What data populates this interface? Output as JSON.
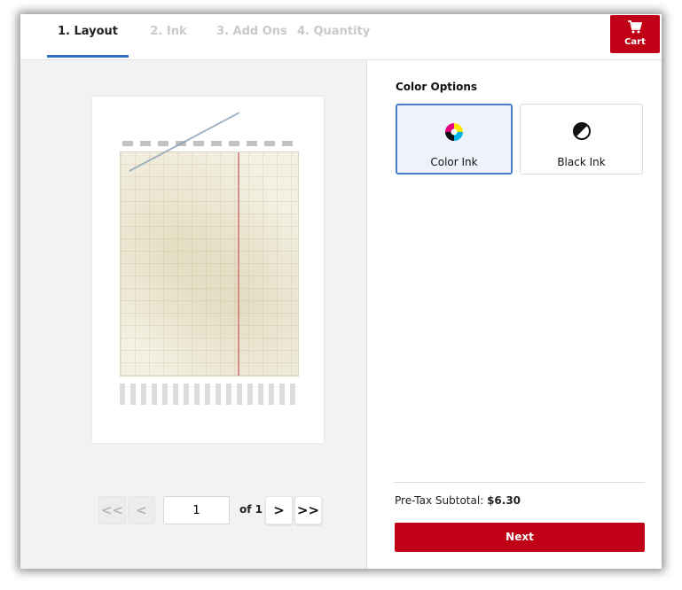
{
  "tabs": [
    {
      "label": "1. Layout",
      "active": true
    },
    {
      "label": "2. Ink",
      "active": false
    },
    {
      "label": "3. Add Ons",
      "active": false
    },
    {
      "label": "4. Quantity",
      "active": false
    }
  ],
  "cart": {
    "label": "Cart",
    "icon": "cart-icon"
  },
  "pager": {
    "first_icon": "double-chevron-left-icon",
    "prev_icon": "chevron-left-icon",
    "next_icon": "chevron-right-icon",
    "last_icon": "double-chevron-right-icon",
    "first_label": "<<",
    "prev_label": "<",
    "next_label": ">",
    "last_label": ">>",
    "current_page": "1",
    "of_label": "of 1"
  },
  "color_options": {
    "title": "Color Options",
    "options": [
      {
        "label": "Color Ink",
        "icon": "cmyk-color-icon",
        "selected": true
      },
      {
        "label": "Black Ink",
        "icon": "half-circle-black-icon",
        "selected": false
      }
    ]
  },
  "summary": {
    "subtotal_label": "Pre-Tax Subtotal:",
    "subtotal_value": "$6.30",
    "next_label": "Next"
  },
  "colors": {
    "accent_red": "#c00015",
    "tab_active_underline": "#2f6fcb",
    "selected_border": "#4a7fc8"
  }
}
